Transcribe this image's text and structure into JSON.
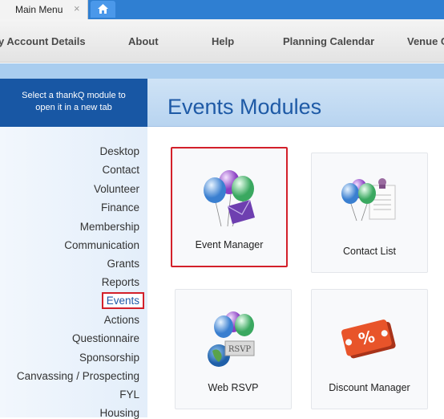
{
  "tabs": [
    {
      "label": "Main Menu",
      "close": "×"
    },
    {
      "icon": "home-icon"
    }
  ],
  "topnav": [
    "y Account Details",
    "About",
    "Help",
    "Planning Calendar",
    "Venue C"
  ],
  "sidebar": {
    "header_line1": "Select a thankQ module to",
    "header_line2": "open it in a new tab",
    "items": [
      "Desktop",
      "Contact",
      "Volunteer",
      "Finance",
      "Membership",
      "Communication",
      "Grants",
      "Reports",
      "Events",
      "Actions",
      "Questionnaire",
      "Sponsorship",
      "Canvassing / Prospecting",
      "FYL",
      "Housing"
    ],
    "active": "Events"
  },
  "main": {
    "title": "Events Modules",
    "tiles": [
      {
        "label": "Event Manager",
        "icon": "event-manager-icon",
        "rsvp": ""
      },
      {
        "label": "Contact List",
        "icon": "contact-list-icon"
      },
      {
        "label": "Web RSVP",
        "icon": "web-rsvp-icon",
        "rsvp": "RSVP"
      },
      {
        "label": "Discount Manager",
        "icon": "discount-manager-icon",
        "percent": "%"
      }
    ]
  },
  "colors": {
    "accent": "#1857a4",
    "highlight": "#d3202a",
    "tabbar": "#2f7fd2"
  }
}
